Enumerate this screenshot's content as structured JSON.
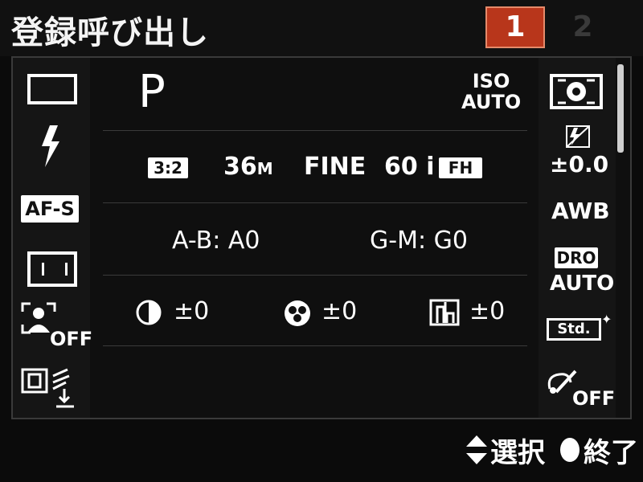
{
  "header": {
    "title": "登録呼び出し",
    "tab_active": "1",
    "tab_inactive": "2"
  },
  "left": {
    "af_mode": "AF-S",
    "face_off": "OFF"
  },
  "main": {
    "mode": "P",
    "iso_top": "ISO",
    "iso_bottom": "AUTO",
    "aspect": "3:2",
    "size": "36",
    "size_unit": "M",
    "quality": "FINE",
    "movie": "60 i",
    "movie_badge": "FH",
    "ab": "A-B: A0",
    "gm": "G-M: G0",
    "contrast": "±0",
    "saturation": "±0",
    "sharpness": "±0"
  },
  "right": {
    "flash_comp": "±0.0",
    "wb": "AWB",
    "dro_top": "DRO",
    "dro_bottom": "AUTO",
    "creative": "Std.",
    "effect_off": "OFF"
  },
  "footer": {
    "select": "選択",
    "end": "終了"
  }
}
